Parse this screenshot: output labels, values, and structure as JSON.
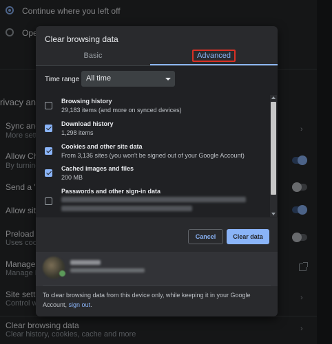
{
  "background": {
    "startup_option_1": "Continue where you left off",
    "startup_option_2": "Open",
    "section_privacy": "rivacy and s",
    "sync_title": "Sync and G",
    "sync_sub": "More setti",
    "allow_chrome_title": "Allow Chro",
    "allow_chrome_sub": "By turning",
    "dnt_title": "Send a 'Do",
    "allow_sites_title": "Allow sites",
    "preload_title": "Preload pa",
    "preload_sub": "Uses cooki",
    "manage_title": "Manage ce",
    "manage_sub": "Manage H",
    "site_settings_title": "Site setting",
    "site_settings_sub": "Control wh",
    "clear_title": "Clear browsing data",
    "clear_sub": "Clear history, cookies, cache and more"
  },
  "dialog": {
    "title": "Clear browsing data",
    "tabs": {
      "basic": "Basic",
      "advanced": "Advanced"
    },
    "time_range_label": "Time range",
    "time_range_value": "All time",
    "items": [
      {
        "title": "Browsing history",
        "sub": "29,183 items (and more on synced devices)",
        "checked": false
      },
      {
        "title": "Download history",
        "sub": "1,298 items",
        "checked": true
      },
      {
        "title": "Cookies and other site data",
        "sub": "From 3,136 sites (you won't be signed out of your Google Account)",
        "checked": true
      },
      {
        "title": "Cached images and files",
        "sub": "200 MB",
        "checked": true
      },
      {
        "title": "Passwords and other sign-in data",
        "sub": "",
        "checked": false
      }
    ],
    "buttons": {
      "cancel": "Cancel",
      "clear": "Clear data"
    },
    "footer_text": "To clear browsing data from this device only, while keeping it in your Google Account,",
    "footer_link": "sign out",
    "footer_end": "."
  },
  "colors": {
    "accent": "#8ab4f8",
    "highlight_border": "#d93025"
  }
}
